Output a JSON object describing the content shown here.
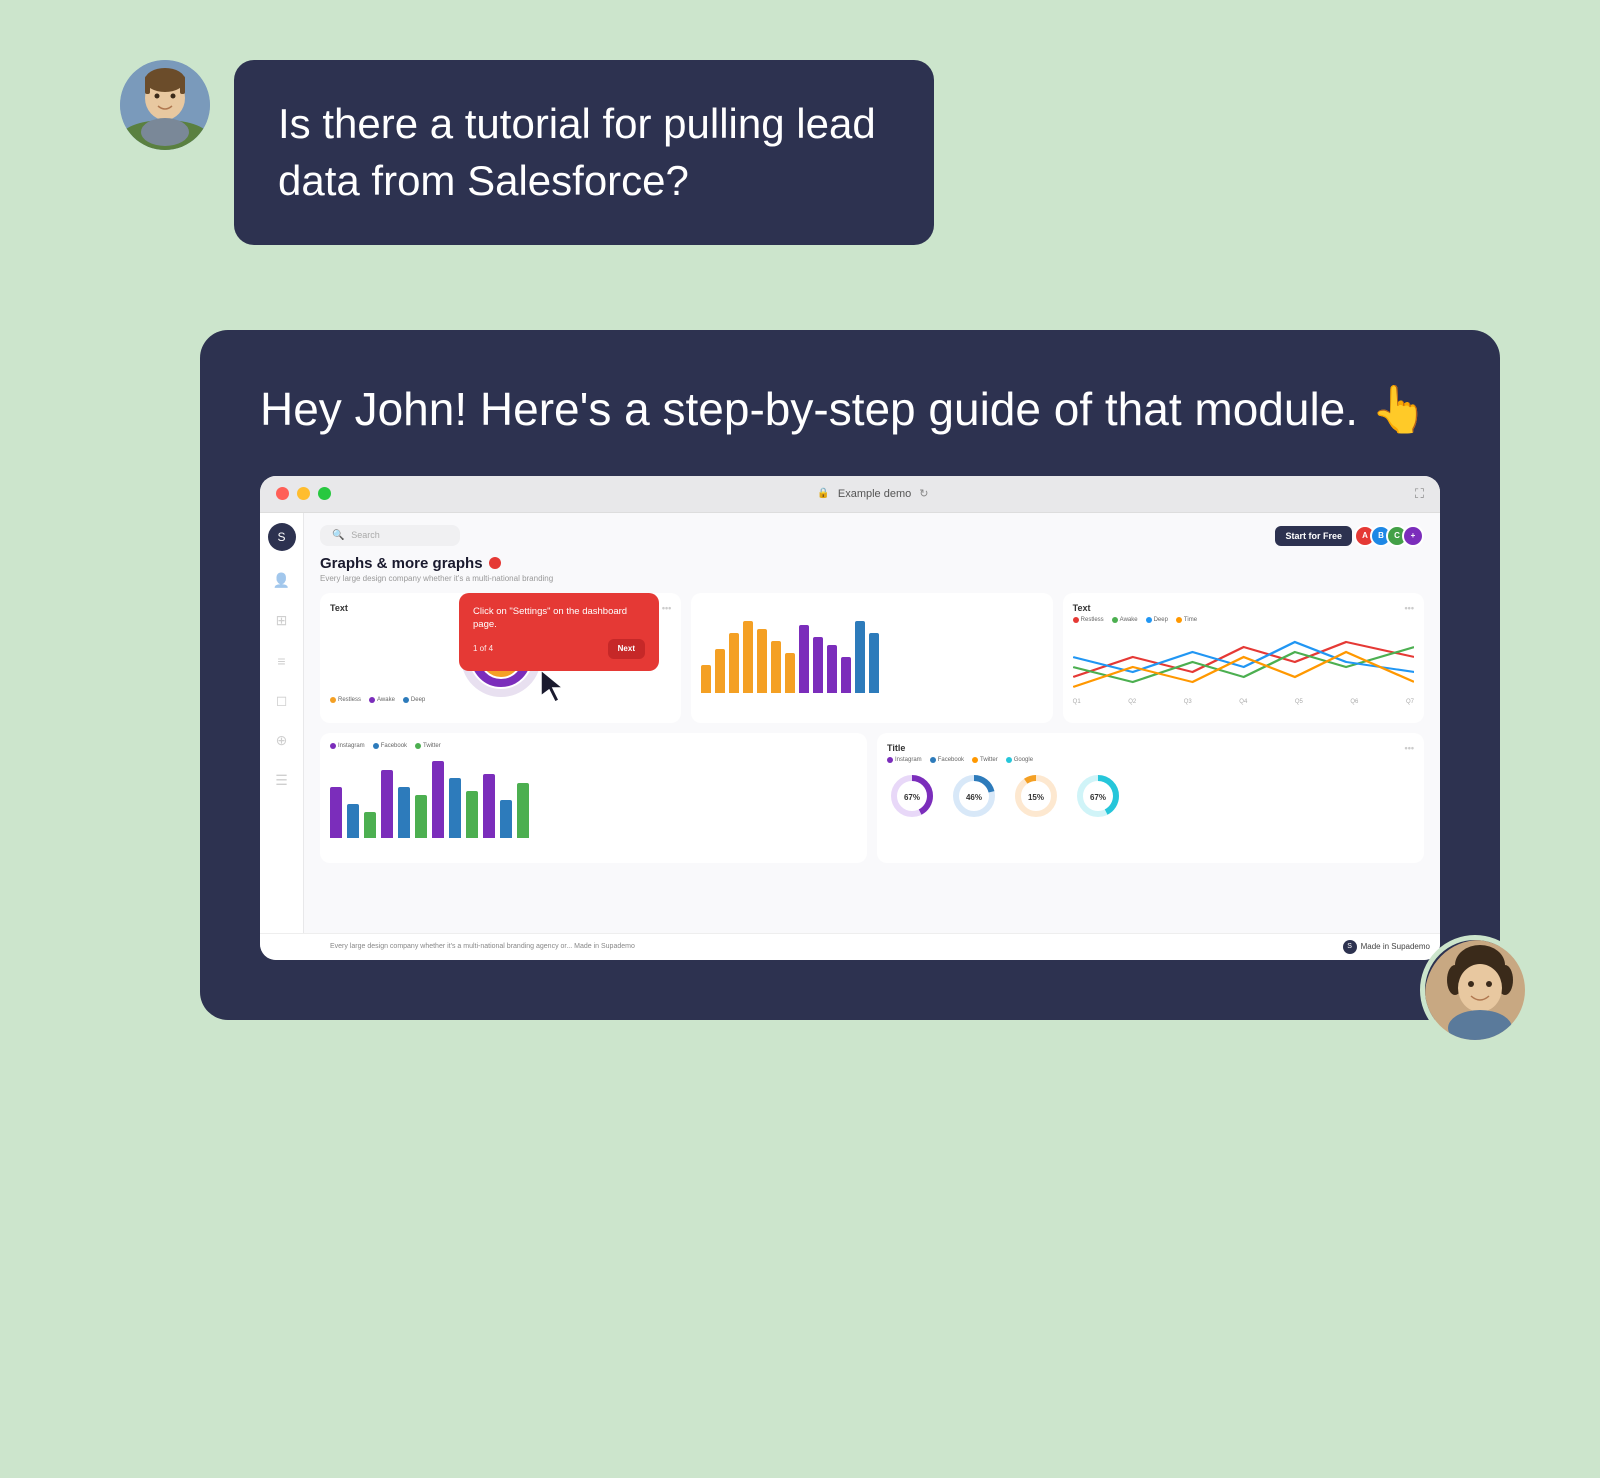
{
  "background_color": "#cce5cc",
  "user_message": {
    "text": "Is there a tutorial for pulling lead data from Salesforce?",
    "avatar_emoji": "👨"
  },
  "bot_response": {
    "text": "Hey John! Here's a step-by-step guide of that module. 👆",
    "avatar_emoji": "👩"
  },
  "demo_window": {
    "title": "Example demo",
    "page_title": "Graphs & more graphs",
    "page_subtitle": "Every large design company whether it's a multi-national branding",
    "search_placeholder": "Search",
    "start_btn": "Start for Free",
    "charts": {
      "top_left": {
        "title": "Text",
        "legend": [
          "Restless",
          "Awake",
          "Deep"
        ],
        "legend_colors": [
          "#f4a024",
          "#7b2dbb",
          "#2d7bbb"
        ]
      },
      "top_middle": {
        "bars": [
          30,
          50,
          70,
          90,
          75,
          60,
          45,
          80,
          65,
          55,
          40,
          85,
          70
        ]
      },
      "top_right": {
        "title": "Text",
        "legend": [
          "Restless",
          "Awake",
          "Deep",
          "Time"
        ],
        "legend_colors": [
          "#e53935",
          "#4caf50",
          "#2196f3",
          "#ff9800"
        ],
        "x_labels": [
          "Q1",
          "Q2",
          "Q3",
          "Q4",
          "Q5",
          "Q6",
          "Q7"
        ]
      },
      "bottom_left": {
        "legend": [
          "Instagram",
          "Facebook",
          "Twitter"
        ],
        "legend_colors": [
          "#7b2dbb",
          "#2d7bbb",
          "#4caf50"
        ]
      },
      "bottom_right": {
        "title": "Title",
        "legend": [
          "Instagram",
          "Facebook",
          "Twitter",
          "Google"
        ],
        "legend_colors": [
          "#7b2dbb",
          "#2d7bbb",
          "#4caf50",
          "#ff9800"
        ],
        "donuts": [
          {
            "pct": "67%",
            "color": "#7b2dbb",
            "bg": "#e8d8f8"
          },
          {
            "pct": "46%",
            "color": "#2d7bbb",
            "bg": "#d8e8f8"
          },
          {
            "pct": "15%",
            "color": "#f4a024",
            "bg": "#fde8d0"
          },
          {
            "pct": "67%",
            "color": "#26c6da",
            "bg": "#d0f4f8"
          }
        ]
      }
    },
    "tooltip": {
      "text": "Click on \"Settings\" on the dashboard page.",
      "counter": "1 of 4",
      "next_btn": "Next"
    },
    "footer": "Made in Supademo"
  }
}
